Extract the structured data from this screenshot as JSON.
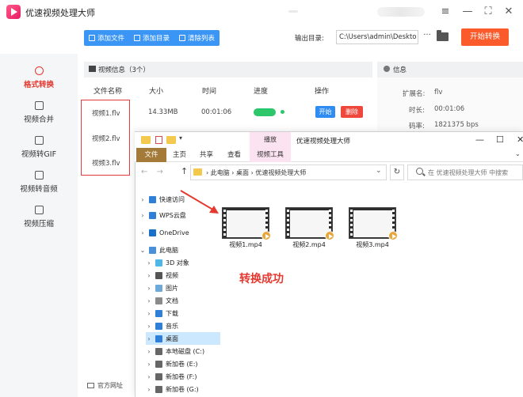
{
  "app": {
    "title": "优速视频处理大师",
    "controls": {
      "menu": "≡",
      "minimize": "—",
      "maximize": "⛶",
      "close": "✕"
    }
  },
  "toolbar": {
    "add_file": "添加文件",
    "add_dir": "添加目录",
    "clear_list": "清除列表",
    "output_label": "输出目录:",
    "output_path": "C:\\Users\\admin\\Deskto",
    "more": "···",
    "convert_label": "开始转换"
  },
  "sidebar": {
    "items": [
      {
        "label": "格式转换",
        "icon": "format-convert-icon",
        "active": true
      },
      {
        "label": "视频合并",
        "icon": "merge-icon",
        "active": false
      },
      {
        "label": "视频转GIF",
        "icon": "gif-icon",
        "active": false
      },
      {
        "label": "视频转音频",
        "icon": "audio-icon",
        "active": false
      },
      {
        "label": "视频压缩",
        "icon": "compress-icon",
        "active": false
      }
    ],
    "footer_link": "官方网址"
  },
  "file_list": {
    "title": "视频信息（3个）",
    "columns": [
      "文件名称",
      "大小",
      "时间",
      "进度",
      "操作"
    ],
    "rows": [
      {
        "name": "视频1.flv",
        "size": "14.33MB",
        "time": "00:01:06",
        "progress": 1.0
      },
      {
        "name": "视频2.flv"
      },
      {
        "name": "视频3.flv"
      }
    ],
    "btn_start": "开始",
    "btn_delete": "删除"
  },
  "info": {
    "title": "信息",
    "lines": [
      {
        "label": "扩展名:",
        "value": "flv"
      },
      {
        "label": "时长:",
        "value": "00:01:06"
      },
      {
        "label": "码率:",
        "value": "1821375 bps"
      }
    ]
  },
  "explorer": {
    "window_title": "优速视频处理大师",
    "context_tab": "播放",
    "ribbon_tabs": [
      "文件",
      "主页",
      "共享",
      "查看",
      "视频工具"
    ],
    "address": [
      "此电脑",
      "桌面",
      "优速视频处理大师"
    ],
    "search_placeholder": "在 优速视频处理大师 中搜索",
    "nav": [
      {
        "label": "快速访问",
        "icon": "star-icon",
        "color": "#2f7fd8"
      },
      {
        "label": "WPS云盘",
        "icon": "cloud-icon",
        "color": "#2f7fd8"
      },
      {
        "label": "OneDrive",
        "icon": "onedrive-icon",
        "color": "#1a6fc9"
      },
      {
        "label": "此电脑",
        "icon": "computer-icon",
        "color": "#4a90d9"
      },
      {
        "label": "3D 对象",
        "icon": "3d-icon",
        "color": "#4fb6e8"
      },
      {
        "label": "视频",
        "icon": "video-folder-icon",
        "color": "#555"
      },
      {
        "label": "图片",
        "icon": "picture-folder-icon",
        "color": "#6fa9d8"
      },
      {
        "label": "文档",
        "icon": "document-folder-icon",
        "color": "#8a8a8a"
      },
      {
        "label": "下载",
        "icon": "download-folder-icon",
        "color": "#2f7fd8"
      },
      {
        "label": "音乐",
        "icon": "music-folder-icon",
        "color": "#2f7fd8"
      },
      {
        "label": "桌面",
        "icon": "desktop-folder-icon",
        "color": "#2f7fd8",
        "selected": true
      },
      {
        "label": "本地磁盘 (C:)",
        "icon": "drive-icon",
        "color": "#666"
      },
      {
        "label": "新加卷 (E:)",
        "icon": "drive-icon",
        "color": "#666"
      },
      {
        "label": "新加卷 (F:)",
        "icon": "drive-icon",
        "color": "#666"
      },
      {
        "label": "新加卷 (G:)",
        "icon": "drive-icon",
        "color": "#666"
      }
    ],
    "files": [
      "视频1.mp4",
      "视频2.mp4",
      "视频3.mp4"
    ]
  },
  "annotation": {
    "success_text": "转换成功"
  },
  "colors": {
    "accent": "#fb5a2a",
    "primary": "#3a95f5",
    "highlight": "#e5382f"
  }
}
